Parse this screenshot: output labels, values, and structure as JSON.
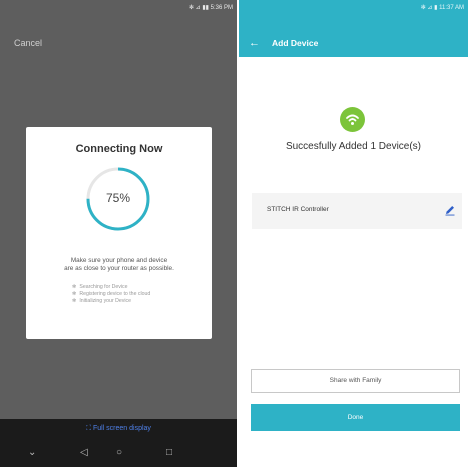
{
  "left_screen": {
    "status_bar": "✻ ⊿ ▮▮ 5:36 PM",
    "cancel_label": "Cancel",
    "dialog": {
      "title": "Connecting Now",
      "progress_percent": 75,
      "progress_label": "75%",
      "hint_line1": "Make sure your phone and device",
      "hint_line2": "are as close to your router as possible.",
      "steps": [
        "Searching for Device",
        "Registering device to the cloud",
        "Initializing your Device"
      ]
    },
    "fullscreen_label": "Full screen display",
    "accent_color": "#2eb2c6"
  },
  "right_screen": {
    "status_bar": "✻ ⊿ ▮ 11:37 AM",
    "header_title": "Add Device",
    "success_message": "Succesfully Added 1 Device(s)",
    "device_name": "STITCH IR Controller",
    "share_label": "Share with Family",
    "done_label": "Done",
    "header_color": "#2eb2c6",
    "success_icon_color": "#7cc43a"
  }
}
